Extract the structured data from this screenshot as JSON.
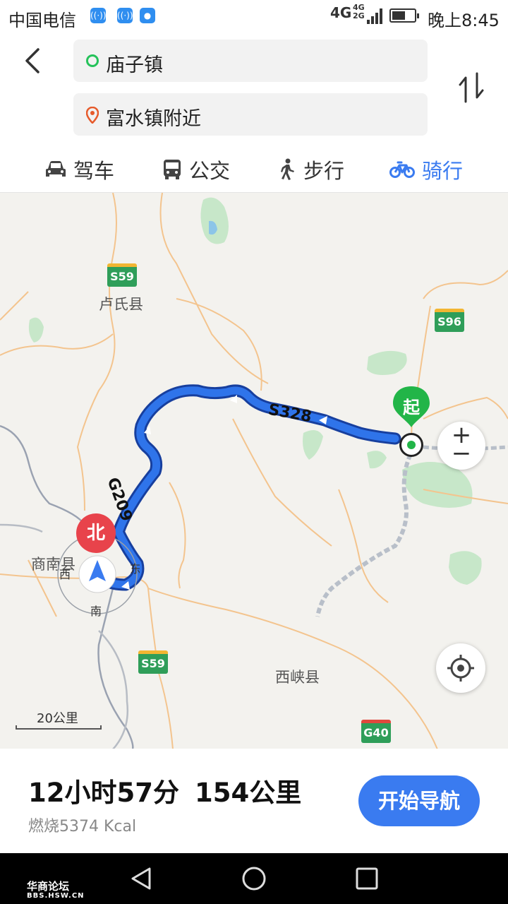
{
  "status_bar": {
    "carrier": "中国电信",
    "network": "4G",
    "network_small_top": "4G",
    "network_small_bottom": "2G",
    "time": "晚上8:45"
  },
  "route": {
    "origin": "庙子镇",
    "destination": "富水镇附近"
  },
  "modes": [
    {
      "label": "驾车",
      "icon": "car-icon",
      "active": false
    },
    {
      "label": "公交",
      "icon": "bus-icon",
      "active": false
    },
    {
      "label": "步行",
      "icon": "walk-icon",
      "active": false
    },
    {
      "label": "骑行",
      "icon": "bike-icon",
      "active": true
    }
  ],
  "map": {
    "places": [
      "卢氏县",
      "商南县",
      "西峡县"
    ],
    "shields": [
      "S59",
      "S96",
      "S59",
      "G40"
    ],
    "road_labels": {
      "s328": "S328",
      "g209": "G209"
    },
    "start_marker": "起",
    "compass": {
      "north": "北",
      "south": "南",
      "east": "东",
      "west": "西"
    },
    "scale": "20公里",
    "zoom_in": "+",
    "zoom_out": "−"
  },
  "summary": {
    "duration": "12小时57分",
    "distance": "154公里",
    "calories": "燃烧5374 Kcal",
    "start_nav_label": "开始导航"
  },
  "watermark": {
    "text": "华商论坛",
    "sub": "BBS.HSW.CN"
  },
  "colors": {
    "accent": "#3a7bf0",
    "route": "#2467e0",
    "start_green": "#22b548",
    "north_red": "#e8434b",
    "highway_green": "#2f9e59"
  }
}
